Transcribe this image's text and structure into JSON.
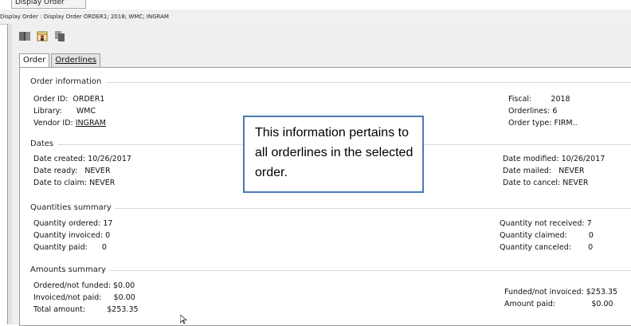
{
  "window": {
    "top_tab": "Display Order",
    "title": "Display Order : Display Order  ORDER1; 2018; WMC; INGRAM"
  },
  "toolbar": {
    "icons": [
      "book-icon",
      "calendar-person-icon",
      "copy-pages-icon"
    ]
  },
  "tabs": [
    {
      "label": "Order",
      "active": true
    },
    {
      "label": "Orderlines",
      "active": false
    }
  ],
  "order_info": {
    "title": "Order information",
    "left": [
      {
        "label": "Order ID:",
        "value": "ORDER1"
      },
      {
        "label": "Library:",
        "value": "WMC"
      },
      {
        "label": "Vendor ID:",
        "value": "INGRAM"
      }
    ],
    "right": [
      {
        "label": "Fiscal:",
        "value": "2018"
      },
      {
        "label": "Orderlines:",
        "value": "6"
      },
      {
        "label": "Order type:",
        "value": "FIRM.."
      }
    ]
  },
  "dates": {
    "title": "Dates",
    "left": [
      {
        "label": "Date created:",
        "value": "10/26/2017"
      },
      {
        "label": "Date ready:",
        "value": "NEVER"
      },
      {
        "label": "Date to claim:",
        "value": "NEVER"
      }
    ],
    "right": [
      {
        "label": "Date modified:",
        "value": "10/26/2017"
      },
      {
        "label": "Date mailed:",
        "value": "NEVER"
      },
      {
        "label": "Date to cancel:",
        "value": "NEVER"
      }
    ]
  },
  "quantities": {
    "title": "Quantities summary",
    "left": [
      {
        "label": "Quantity ordered:",
        "value": "17"
      },
      {
        "label": "Quantity invoiced:",
        "value": "0"
      },
      {
        "label": "Quantity paid:",
        "value": "0"
      }
    ],
    "right": [
      {
        "label": "Quantity not received:",
        "value": "7"
      },
      {
        "label": "Quantity claimed:",
        "value": "0"
      },
      {
        "label": "Quantity canceled:",
        "value": "0"
      }
    ]
  },
  "amounts": {
    "title": "Amounts summary",
    "left": [
      {
        "label": "Ordered/not funded:",
        "value": "$0.00"
      },
      {
        "label": "Invoiced/not paid:",
        "value": "$0.00"
      },
      {
        "label": "Total amount:",
        "value": "$253.35"
      }
    ],
    "right": [
      {
        "label": "Funded/not invoiced:",
        "value": "$253.35"
      },
      {
        "label": "Amount paid:",
        "value": "$0.00"
      }
    ]
  },
  "callout": {
    "text": "This information pertains to all orderlines in the selected order."
  }
}
